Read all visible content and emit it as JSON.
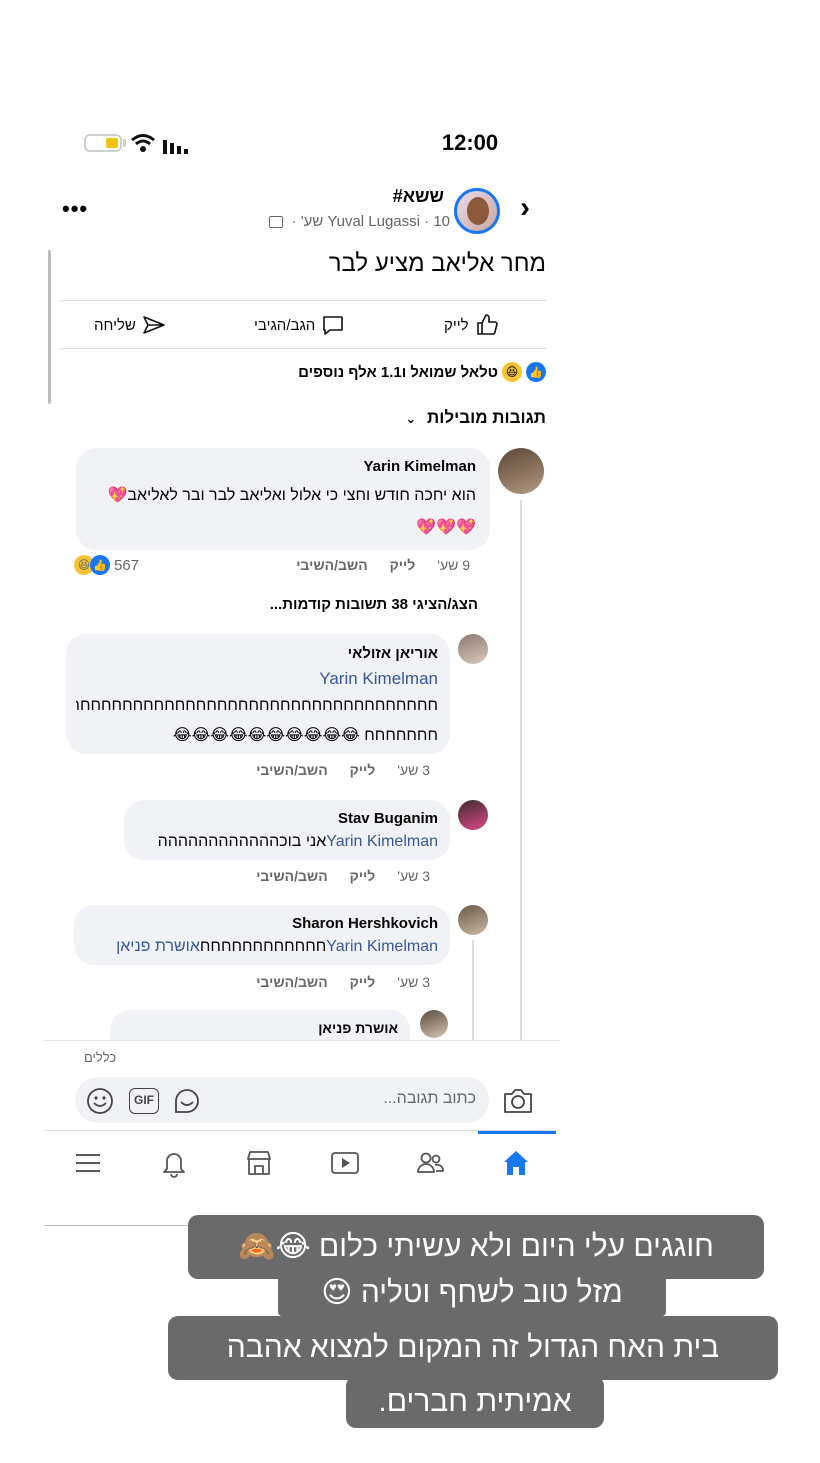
{
  "status_bar": {
    "time": "12:00"
  },
  "post": {
    "page_name": "ששא#",
    "meta": "Yuval Lugassi · 10 שע' ·",
    "text": "מחר אליאב מציע לבר",
    "actions": {
      "like": "לייק",
      "comment": "הגב/הגיבי",
      "share": "שליחה"
    },
    "reactions_summary": "טלאל שמואל ו1.1 אלף נוספים"
  },
  "comments_section": {
    "sort_label": "תגובות מובילות",
    "top_comment": {
      "author": "Yarin Kimelman",
      "text_line1": "הוא יחכה חודש וחצי כי אלול ואליאב לבר ובר לאליאב💖",
      "text_line2": "💖💖💖",
      "time": "9 שע'",
      "like": "לייק",
      "reply": "השב/השיבי",
      "reaction_count": "567"
    },
    "view_previous": "הצג/הציגי 38 תשובות קודמות...",
    "replies": [
      {
        "author": "אוריאן אזולאי",
        "mention": "Yarin Kimelman",
        "text_line1": "חחחחחחחחחחחחחחחחחחחחחחחחחחחחחחחחחחחחחח",
        "text_line2": "חחחחחחח 😂😂😂😂😂😂😂😂😂😂",
        "time": "3 שע'",
        "like": "לייק",
        "reply": "השב/השיבי"
      },
      {
        "author": "Stav Buganim",
        "mention": "Yarin Kimelman",
        "text": "אני בוכהההההההההההה",
        "time": "3 שע'",
        "like": "לייק",
        "reply": "השב/השיבי"
      },
      {
        "author": "Sharon Hershkovich",
        "mention": "Yarin Kimelman",
        "text": "חחחחחחחחחחחח",
        "mention2": "אושרת פניאן",
        "time": "3 שע'",
        "like": "לייק",
        "reply": "השב/השיבי"
      },
      {
        "author": "אושרת פניאן"
      }
    ]
  },
  "composer": {
    "label": "כללים",
    "placeholder": "כתוב תגובה..."
  },
  "story_captions": {
    "line1": "חוגגים עלי היום ולא עשיתי כלום 😂🙈",
    "line2": "מזל טוב לשחף וטליה 😍",
    "line3": "בית האח הגדול זה המקום למצוא אהבה",
    "line4": "אמיתית חברים."
  },
  "icons": {
    "camera": "camera-icon",
    "gif": "gif-icon",
    "emoji": "emoji-icon",
    "sticker": "sticker-icon",
    "home": "home-icon",
    "friends": "friends-icon",
    "watch": "watch-icon",
    "marketplace": "marketplace-icon",
    "notifications": "bell-icon",
    "menu": "menu-icon"
  },
  "colors": {
    "accent": "#1877f2",
    "caption_bg": "#6a6a6a",
    "mention": "#385898"
  }
}
